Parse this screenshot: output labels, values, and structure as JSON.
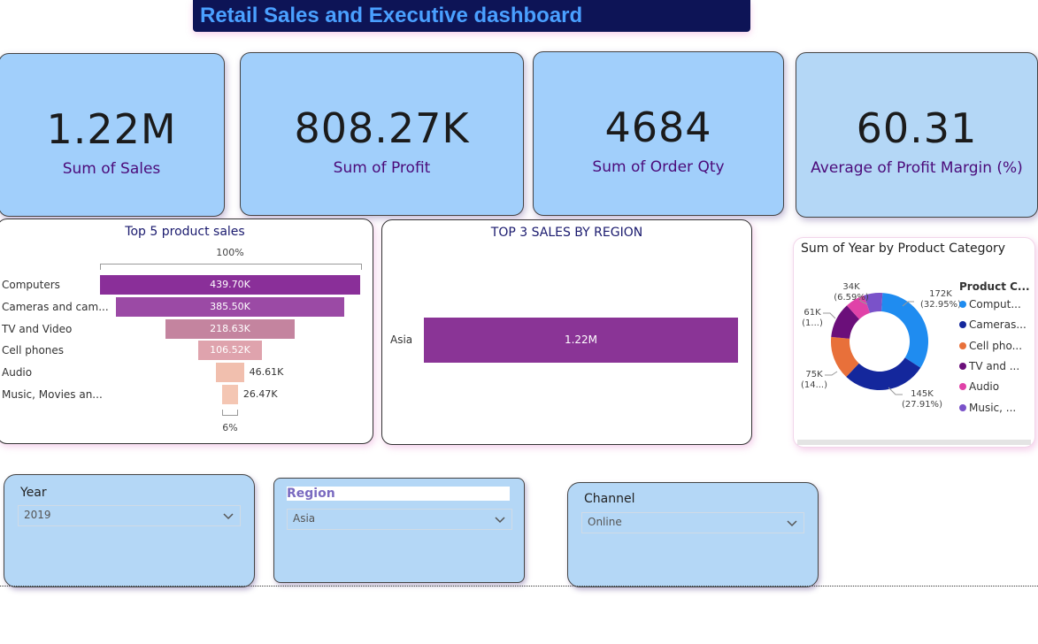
{
  "header": {
    "title": "Retail Sales and Executive dashboard"
  },
  "kpis": [
    {
      "value": "1.22M",
      "label": "Sum of Sales"
    },
    {
      "value": "808.27K",
      "label": "Sum of Profit"
    },
    {
      "value": "4684",
      "label": "Sum of Order Qty"
    },
    {
      "value": "60.31",
      "label": "Average of Profit Margin (%)"
    }
  ],
  "funnel": {
    "title": "Top 5 product sales",
    "top_pct": "100%",
    "bottom_pct": "6%",
    "labels": [
      "Computers",
      "Cameras and cam...",
      "TV and Video",
      "Cell phones",
      "Audio",
      "Music, Movies an..."
    ],
    "value_labels": [
      "439.70K",
      "385.50K",
      "218.63K",
      "106.52K",
      "46.61K",
      "26.47K"
    ]
  },
  "region_chart": {
    "title": "TOP 3 SALES BY REGION",
    "category": "Asia",
    "value_label": "1.22M"
  },
  "donut": {
    "title": "Sum of Year by Product Category",
    "legend_title": "Product C...",
    "legend": [
      "Comput...",
      "Cameras...",
      "Cell pho...",
      "TV and ...",
      "Audio",
      "Music, ..."
    ],
    "labels": {
      "computers": [
        "172K",
        "(32.95%)"
      ],
      "cameras": [
        "145K",
        "(27.91%)"
      ],
      "cell": [
        "75K",
        "(14...)"
      ],
      "tv": [
        "61K",
        "(1...)"
      ],
      "audio": [
        "34K",
        "(6.59%)"
      ]
    }
  },
  "slicers": {
    "year": {
      "title": "Year",
      "value": "2019"
    },
    "region": {
      "title": "Region",
      "value": "Asia"
    },
    "channel": {
      "title": "Channel",
      "value": "Online"
    }
  },
  "colors": {
    "title_bg": "#0d1456",
    "title_text": "#4aa0ff",
    "kpi_bg": "#a1cffb",
    "kpi_label": "#4b0b7a",
    "funnel": [
      "#8a2f99",
      "#9b4aa5",
      "#c4849f",
      "#dfa3ad",
      "#f1bfae",
      "#f4c6b3"
    ],
    "region_bar": "#8a3496",
    "donut": [
      "#1f8cf0",
      "#14279c",
      "#e8703a",
      "#6b0f7a",
      "#e042a8",
      "#7a52c9"
    ]
  },
  "chart_data": [
    {
      "type": "bar",
      "title": "Top 5 product sales",
      "categories": [
        "Computers",
        "Cameras and cam...",
        "TV and Video",
        "Cell phones",
        "Audio",
        "Music, Movies an..."
      ],
      "values": [
        439700,
        385500,
        218630,
        106520,
        46610,
        26470
      ]
    },
    {
      "type": "bar",
      "title": "TOP 3 SALES BY REGION",
      "categories": [
        "Asia"
      ],
      "values": [
        1220000
      ]
    },
    {
      "type": "pie",
      "title": "Sum of Year by Product Category",
      "categories": [
        "Computers",
        "Cameras",
        "Cell phones",
        "TV and Video",
        "Audio",
        "Music, Movies"
      ],
      "values": [
        172,
        145,
        75,
        61,
        34,
        32
      ]
    }
  ]
}
